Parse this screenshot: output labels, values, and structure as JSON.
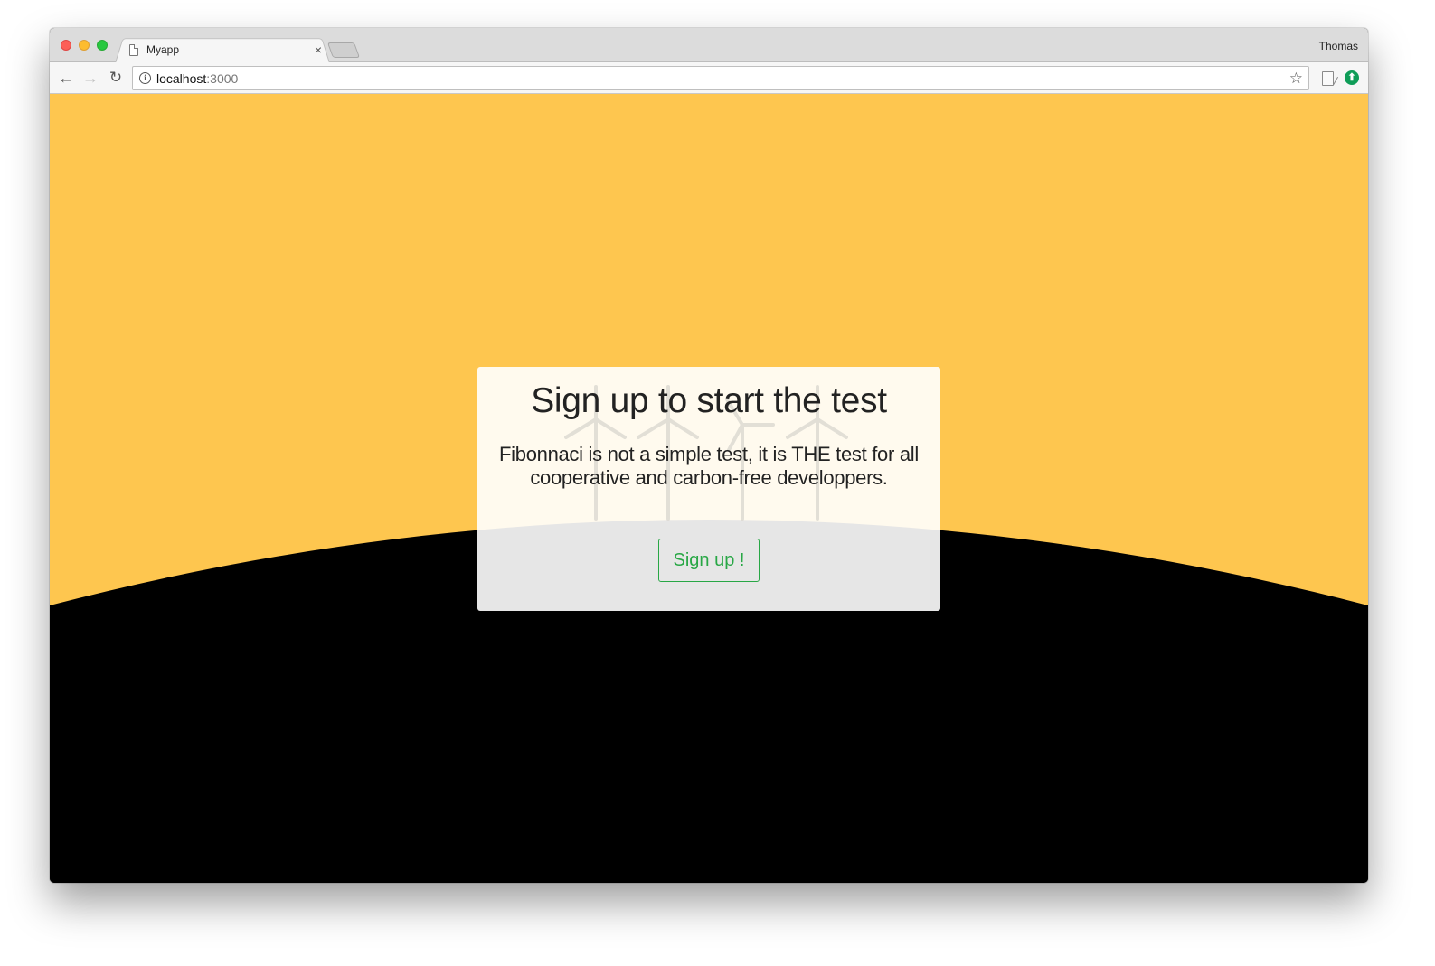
{
  "browser": {
    "tab_title": "Myapp",
    "tab_close": "×",
    "profile_name": "Thomas",
    "url_host": "localhost",
    "url_port": ":3000",
    "back_glyph": "←",
    "forward_glyph": "→",
    "reload_glyph": "↻",
    "info_glyph": "i",
    "star_glyph": "☆",
    "update_glyph": "⬆"
  },
  "page": {
    "colors": {
      "sky": "#fec64f",
      "ground": "#000000",
      "button": "#28a745"
    },
    "card": {
      "title": "Sign up to start the test",
      "text": "Fibonnaci is not a simple test, it is THE test for all cooperative and carbon-free developpers.",
      "button_label": "Sign up !"
    }
  }
}
